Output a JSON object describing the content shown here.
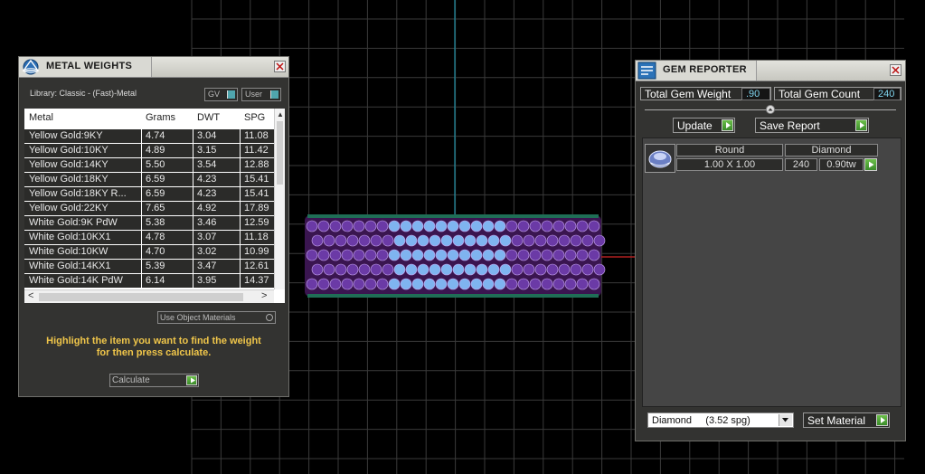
{
  "metal_weights": {
    "title": "METAL WEIGHTS",
    "library_label": "Library: Classic - (Fast)-Metal",
    "gv_toggle": "GV",
    "user_toggle": "User",
    "columns": [
      "Metal",
      "Grams",
      "DWT",
      "SPG"
    ],
    "rows": [
      {
        "metal": "Yellow Gold:9KY",
        "grams": "4.74",
        "dwt": "3.04",
        "spg": "11.08"
      },
      {
        "metal": "Yellow Gold:10KY",
        "grams": "4.89",
        "dwt": "3.15",
        "spg": "11.42"
      },
      {
        "metal": "Yellow Gold:14KY",
        "grams": "5.50",
        "dwt": "3.54",
        "spg": "12.88"
      },
      {
        "metal": "Yellow Gold:18KY",
        "grams": "6.59",
        "dwt": "4.23",
        "spg": "15.41"
      },
      {
        "metal": "Yellow Gold:18KY R...",
        "grams": "6.59",
        "dwt": "4.23",
        "spg": "15.41"
      },
      {
        "metal": "Yellow Gold:22KY",
        "grams": "7.65",
        "dwt": "4.92",
        "spg": "17.89"
      },
      {
        "metal": "White Gold:9K PdW",
        "grams": "5.38",
        "dwt": "3.46",
        "spg": "12.59"
      },
      {
        "metal": "White Gold:10KX1",
        "grams": "4.78",
        "dwt": "3.07",
        "spg": "11.18"
      },
      {
        "metal": "White Gold:10KW",
        "grams": "4.70",
        "dwt": "3.02",
        "spg": "10.99"
      },
      {
        "metal": "White Gold:14KX1",
        "grams": "5.39",
        "dwt": "3.47",
        "spg": "12.61"
      },
      {
        "metal": "White Gold:14K PdW",
        "grams": "6.14",
        "dwt": "3.95",
        "spg": "14.37"
      }
    ],
    "use_object_materials": "Use Object Materials",
    "instruction_line1": "Highlight the item you want to find the weight",
    "instruction_line2": "for then press calculate.",
    "calculate": "Calculate"
  },
  "gem_reporter": {
    "title": "GEM REPORTER",
    "total_gem_weight_label": "Total Gem Weight",
    "total_gem_weight_value": ".90",
    "total_gem_count_label": "Total Gem Count",
    "total_gem_count_value": "240",
    "update": "Update",
    "save_report": "Save Report",
    "gem_row": {
      "shape": "Round",
      "size": "1.00 X 1.00",
      "material": "Diamond",
      "count": "240",
      "weight": "0.90tw"
    },
    "material_select": "Diamond     (3.52 spg)",
    "set_material": "Set Material"
  },
  "colors": {
    "panel_bg": "#333331",
    "accent_yellow": "#f0c64a",
    "value_cyan": "#7fd4ee",
    "button_green": "#4da234",
    "grid_line": "#3a3a3a",
    "axis_cyan": "#1e8fa6",
    "axis_red": "#b02020",
    "gem_purple": "#7a2fa8",
    "gem_blue": "#7fb4f0"
  }
}
